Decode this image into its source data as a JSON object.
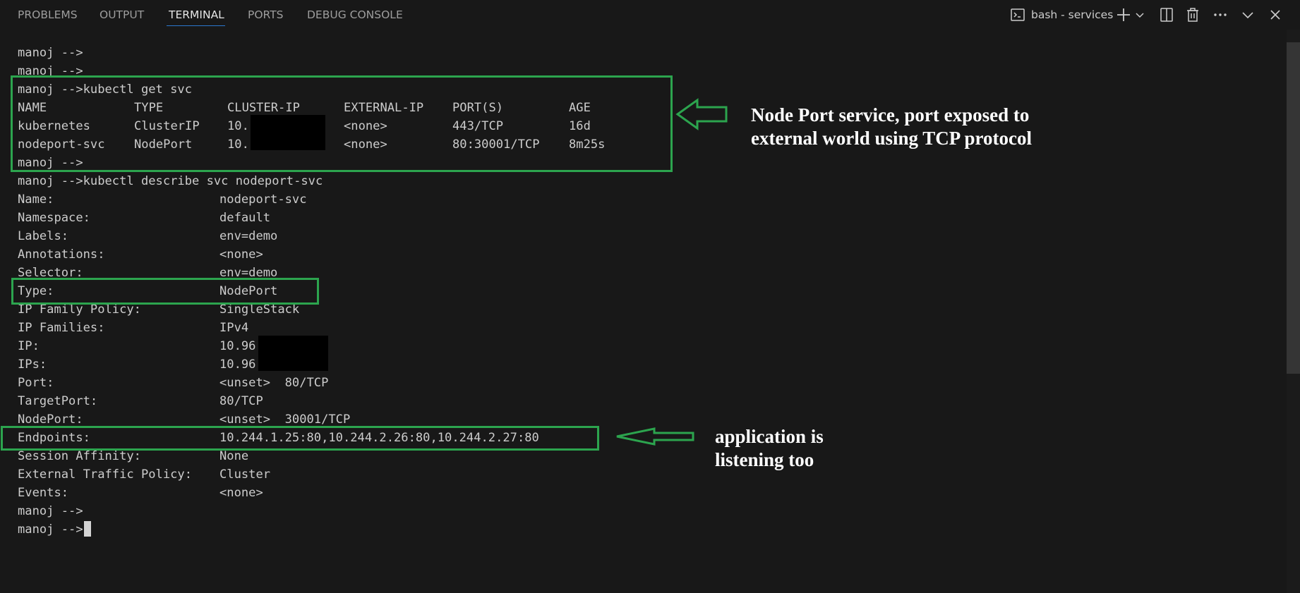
{
  "panel": {
    "tabs": [
      {
        "label": "PROBLEMS"
      },
      {
        "label": "OUTPUT"
      },
      {
        "label": "TERMINAL",
        "active": true
      },
      {
        "label": "PORTS"
      },
      {
        "label": "DEBUG CONSOLE"
      }
    ],
    "terminal_name": "bash - services",
    "icons": [
      "terminal-icon",
      "add-icon",
      "chevron-down-icon",
      "split-icon",
      "trash-icon",
      "more-icon",
      "collapse-icon",
      "close-icon"
    ]
  },
  "terminal": {
    "prompt": "manoj -->",
    "svc_cmd": "kubectl get svc",
    "svc_headers": [
      "NAME",
      "TYPE",
      "CLUSTER-IP",
      "EXTERNAL-IP",
      "PORT(S)",
      "AGE"
    ],
    "svc_rows": [
      [
        "kubernetes",
        "ClusterIP",
        "10.",
        "<none>",
        "443/TCP",
        "16d"
      ],
      [
        "nodeport-svc",
        "NodePort",
        "10.",
        "<none>",
        "80:30001/TCP",
        "8m25s"
      ]
    ],
    "describe_cmd": "kubectl describe svc nodeport-svc",
    "describe_fields": [
      [
        "Name:",
        "nodeport-svc"
      ],
      [
        "Namespace:",
        "default"
      ],
      [
        "Labels:",
        "env=demo"
      ],
      [
        "Annotations:",
        "<none>"
      ],
      [
        "Selector:",
        "env=demo"
      ],
      [
        "Type:",
        "NodePort"
      ],
      [
        "IP Family Policy:",
        "SingleStack"
      ],
      [
        "IP Families:",
        "IPv4"
      ],
      [
        "IP:",
        "10.96"
      ],
      [
        "IPs:",
        "10.96"
      ],
      [
        "Port:",
        "<unset>  80/TCP"
      ],
      [
        "TargetPort:",
        "80/TCP"
      ],
      [
        "NodePort:",
        "<unset>  30001/TCP"
      ],
      [
        "Endpoints:",
        "10.244.1.25:80,10.244.2.26:80,10.244.2.27:80"
      ],
      [
        "Session Affinity:",
        "None"
      ],
      [
        "External Traffic Policy:",
        "Cluster"
      ],
      [
        "Events:",
        "<none>"
      ]
    ]
  },
  "annotations": {
    "service_note": [
      "Node Port service, port exposed to",
      "external world using TCP protocol"
    ],
    "endpoints_note": [
      "application is",
      "listening too"
    ],
    "highlight_color": "#2ca44e"
  }
}
